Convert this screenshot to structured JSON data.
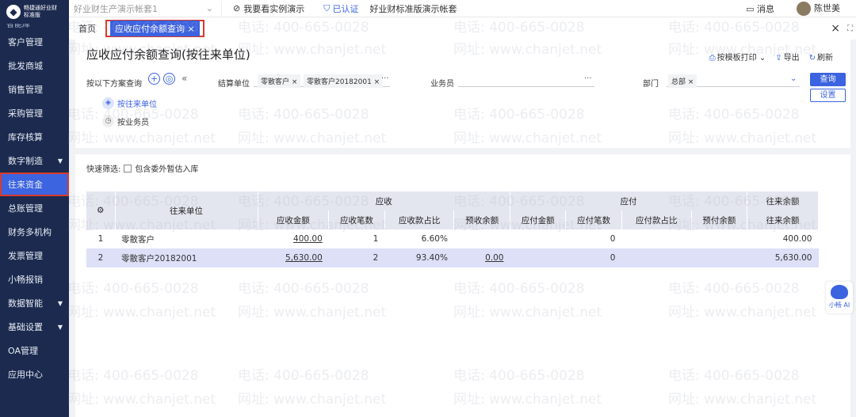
{
  "logo": {
    "brand": "畅捷通好业财",
    "edition": "标准版"
  },
  "sidebar": {
    "first_partial": "智能库",
    "items": [
      {
        "label": "客户管理",
        "caret": false
      },
      {
        "label": "批发商城",
        "caret": false
      },
      {
        "label": "销售管理",
        "caret": false
      },
      {
        "label": "采购管理",
        "caret": false
      },
      {
        "label": "库存核算",
        "caret": false
      },
      {
        "label": "数字制造",
        "caret": true
      },
      {
        "label": "往来资金",
        "caret": false,
        "active": true
      },
      {
        "label": "总账管理",
        "caret": false
      },
      {
        "label": "财务多机构",
        "caret": false
      },
      {
        "label": "发票管理",
        "caret": false
      },
      {
        "label": "小畅报销",
        "caret": false
      },
      {
        "label": "数据智能",
        "caret": true
      },
      {
        "label": "基础设置",
        "caret": true
      },
      {
        "label": "OA管理",
        "caret": false
      },
      {
        "label": "应用中心",
        "caret": false
      }
    ]
  },
  "topbar": {
    "account": "好业财生产演示帐套1",
    "demo_link": "我要看实例演示",
    "verified": "已认证",
    "account_desc": "好业财标准版演示帐套",
    "messages": "消息",
    "user": "陈世美"
  },
  "tabs": {
    "home": "首页",
    "active": "应收应付余额查询",
    "close": "×",
    "close_all": "×"
  },
  "page": {
    "title": "应收应付余额查询(按往来单位)",
    "toolbar": {
      "print": "按模板打印",
      "export": "导出",
      "refresh": "刷新"
    }
  },
  "scheme": {
    "label": "按以下方案查询",
    "options": [
      "按往来单位",
      "按业务员"
    ]
  },
  "filters": {
    "settle_unit_label": "结算单位",
    "settle_chips": [
      "零散客户",
      "零散客户20182001"
    ],
    "salesman_label": "业务员",
    "dept_label": "部门",
    "dept_chips": [
      "总部"
    ],
    "query_btn": "查询",
    "settings_btn": "设置"
  },
  "quick_filter": {
    "label": "快速筛选:",
    "option": "包含委外暂估入库"
  },
  "table": {
    "header_group": {
      "unit": "往来单位",
      "receivable": "应收",
      "payable": "应付",
      "balance": "往来余额"
    },
    "columns": [
      "应收金额",
      "应收笔数",
      "应收款占比",
      "预收余额",
      "应付金额",
      "应付笔数",
      "应付款占比",
      "预付余额",
      "往来余额"
    ],
    "rows": [
      {
        "idx": "1",
        "unit": "零散客户",
        "ar_amount": "400.00",
        "ar_count": "1",
        "ar_ratio": "6.60%",
        "adv_recv": "",
        "ap_amount": "",
        "ap_count": "0",
        "ap_ratio": "",
        "prepay": "",
        "balance": "400.00"
      },
      {
        "idx": "2",
        "unit": "零散客户20182001",
        "ar_amount": "5,630.00",
        "ar_count": "2",
        "ar_ratio": "93.40%",
        "adv_recv": "0.00",
        "ap_amount": "",
        "ap_count": "0",
        "ap_ratio": "",
        "prepay": "",
        "balance": "5,630.00"
      }
    ]
  },
  "watermark": {
    "phone": "电话: 400-665-0028",
    "site": "网址: www.chanjet.net"
  },
  "ai_helper": {
    "label": "小畅 AI"
  },
  "colors": {
    "sidebar": "#1b2a4e",
    "accent": "#3c63e0",
    "highlight_border": "#d93a2b",
    "selected_row": "#dde0f7"
  }
}
